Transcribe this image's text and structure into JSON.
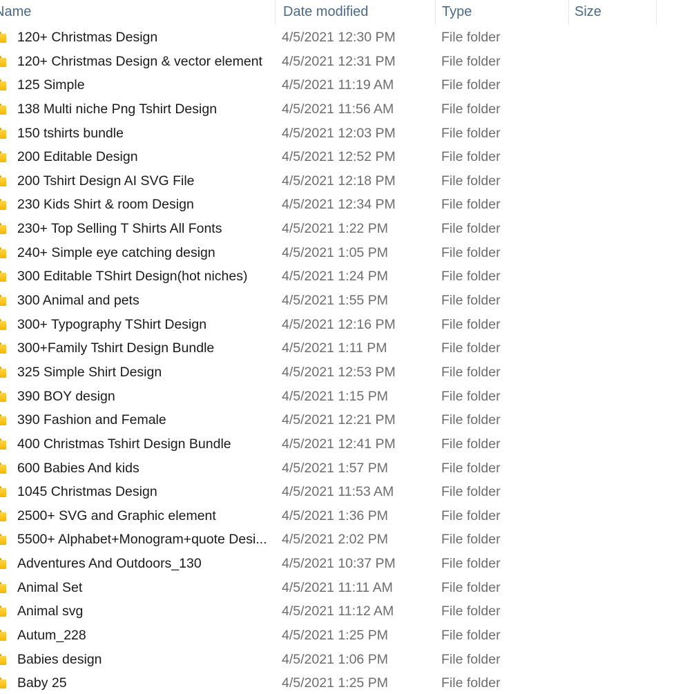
{
  "columns": {
    "name": "Name",
    "date_modified": "Date modified",
    "type": "Type",
    "size": "Size"
  },
  "icons": {
    "folder": "folder-icon",
    "sort": "chevron-up-icon"
  },
  "colors": {
    "folder": "#f5b800",
    "header_text": "#4a6a8c"
  },
  "files": [
    {
      "name": "120+ Christmas Design",
      "date": "4/5/2021 12:30 PM",
      "type": "File folder",
      "size": ""
    },
    {
      "name": "120+ Christmas Design & vector element",
      "date": "4/5/2021 12:31 PM",
      "type": "File folder",
      "size": ""
    },
    {
      "name": "125 Simple",
      "date": "4/5/2021 11:19 AM",
      "type": "File folder",
      "size": ""
    },
    {
      "name": "138 Multi niche Png Tshirt Design",
      "date": "4/5/2021 11:56 AM",
      "type": "File folder",
      "size": ""
    },
    {
      "name": "150 tshirts bundle",
      "date": "4/5/2021 12:03 PM",
      "type": "File folder",
      "size": ""
    },
    {
      "name": "200 Editable Design",
      "date": "4/5/2021 12:52 PM",
      "type": "File folder",
      "size": ""
    },
    {
      "name": "200 Tshirt Design AI SVG File",
      "date": "4/5/2021 12:18 PM",
      "type": "File folder",
      "size": ""
    },
    {
      "name": "230 Kids Shirt & room Design",
      "date": "4/5/2021 12:34 PM",
      "type": "File folder",
      "size": ""
    },
    {
      "name": "230+ Top Selling T Shirts All Fonts",
      "date": "4/5/2021 1:22 PM",
      "type": "File folder",
      "size": ""
    },
    {
      "name": "240+ Simple eye catching design",
      "date": "4/5/2021 1:05 PM",
      "type": "File folder",
      "size": ""
    },
    {
      "name": "300  Editable TShirt Design(hot niches)",
      "date": "4/5/2021 1:24 PM",
      "type": "File folder",
      "size": ""
    },
    {
      "name": "300 Animal and pets",
      "date": "4/5/2021 1:55 PM",
      "type": "File folder",
      "size": ""
    },
    {
      "name": "300+ Typography TShirt Design",
      "date": "4/5/2021 12:16 PM",
      "type": "File folder",
      "size": ""
    },
    {
      "name": "300+Family Tshirt Design Bundle",
      "date": "4/5/2021 1:11 PM",
      "type": "File folder",
      "size": ""
    },
    {
      "name": "325 Simple Shirt Design",
      "date": "4/5/2021 12:53 PM",
      "type": "File folder",
      "size": ""
    },
    {
      "name": "390 BOY design",
      "date": "4/5/2021 1:15 PM",
      "type": "File folder",
      "size": ""
    },
    {
      "name": "390 Fashion and Female",
      "date": "4/5/2021 12:21 PM",
      "type": "File folder",
      "size": ""
    },
    {
      "name": "400 Christmas Tshirt  Design Bundle",
      "date": "4/5/2021 12:41 PM",
      "type": "File folder",
      "size": ""
    },
    {
      "name": "600 Babies And kids",
      "date": "4/5/2021 1:57 PM",
      "type": "File folder",
      "size": ""
    },
    {
      "name": "1045 Christmas Design",
      "date": "4/5/2021 11:53 AM",
      "type": "File folder",
      "size": ""
    },
    {
      "name": "2500+ SVG and Graphic element",
      "date": "4/5/2021 1:36 PM",
      "type": "File folder",
      "size": ""
    },
    {
      "name": "5500+ Alphabet+Monogram+quote Desi...",
      "date": "4/5/2021 2:02 PM",
      "type": "File folder",
      "size": ""
    },
    {
      "name": "Adventures And Outdoors_130",
      "date": "4/5/2021 10:37 PM",
      "type": "File folder",
      "size": ""
    },
    {
      "name": "Animal Set",
      "date": "4/5/2021 11:11 AM",
      "type": "File folder",
      "size": ""
    },
    {
      "name": "Animal svg",
      "date": "4/5/2021 11:12 AM",
      "type": "File folder",
      "size": ""
    },
    {
      "name": "Autum_228",
      "date": "4/5/2021 1:25 PM",
      "type": "File folder",
      "size": ""
    },
    {
      "name": "Babies design",
      "date": "4/5/2021 1:06 PM",
      "type": "File folder",
      "size": ""
    },
    {
      "name": "Baby 25",
      "date": "4/5/2021 1:25 PM",
      "type": "File folder",
      "size": ""
    }
  ]
}
